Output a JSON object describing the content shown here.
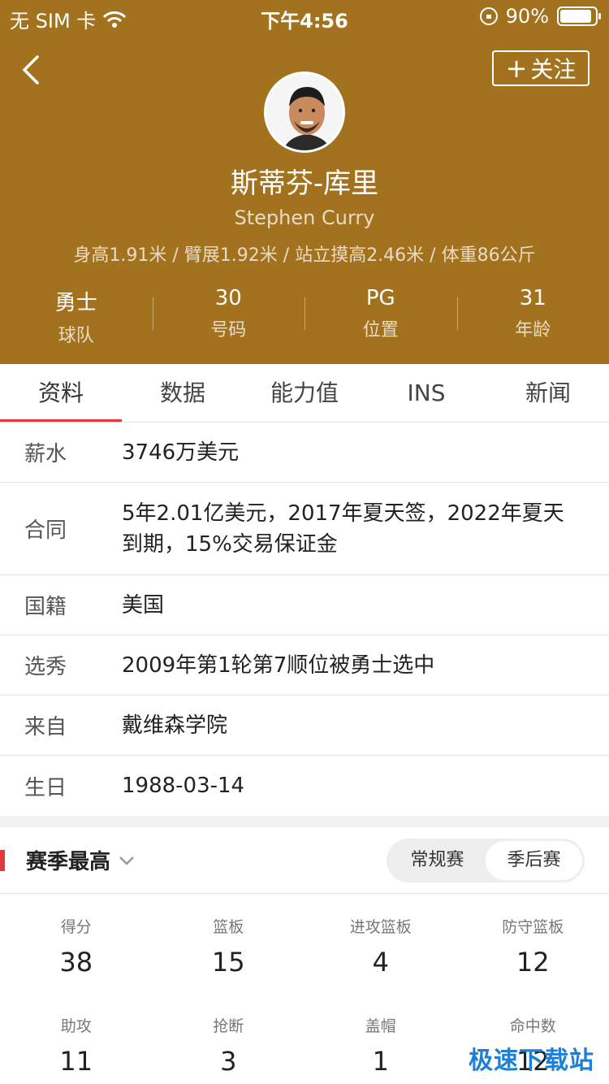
{
  "status": {
    "carrier": "无 SIM 卡",
    "time": "下午4:56",
    "battery": "90%",
    "battery_level": 0.9
  },
  "header": {
    "follow_label": "关注",
    "name_cn": "斯蒂芬-库里",
    "name_en": "Stephen Curry",
    "measurements": "身高1.91米 / 臂展1.92米 / 站立摸高2.46米 / 体重86公斤",
    "stats": [
      {
        "value": "勇士",
        "label": "球队"
      },
      {
        "value": "30",
        "label": "号码"
      },
      {
        "value": "PG",
        "label": "位置"
      },
      {
        "value": "31",
        "label": "年龄"
      }
    ],
    "color": "#a3721f"
  },
  "tabs": [
    "资料",
    "数据",
    "能力值",
    "INS",
    "新闻"
  ],
  "info": [
    {
      "key": "薪水",
      "value": "3746万美元"
    },
    {
      "key": "合同",
      "value": "5年2.01亿美元，2017年夏天签，2022年夏天到期，15%交易保证金"
    },
    {
      "key": "国籍",
      "value": "美国"
    },
    {
      "key": "选秀",
      "value": "2009年第1轮第7顺位被勇士选中"
    },
    {
      "key": "来自",
      "value": "戴维森学院"
    },
    {
      "key": "生日",
      "value": "1988-03-14"
    }
  ],
  "season": {
    "title": "赛季最高",
    "segments": [
      "常规赛",
      "季后赛"
    ],
    "active_segment": "季后赛",
    "stats": [
      {
        "label": "得分",
        "value": "38"
      },
      {
        "label": "篮板",
        "value": "15"
      },
      {
        "label": "进攻篮板",
        "value": "4"
      },
      {
        "label": "防守篮板",
        "value": "12"
      },
      {
        "label": "助攻",
        "value": "11"
      },
      {
        "label": "抢断",
        "value": "3"
      },
      {
        "label": "盖帽",
        "value": "1"
      },
      {
        "label": "命中数",
        "value": "12"
      }
    ]
  },
  "watermark": "极速下载站"
}
